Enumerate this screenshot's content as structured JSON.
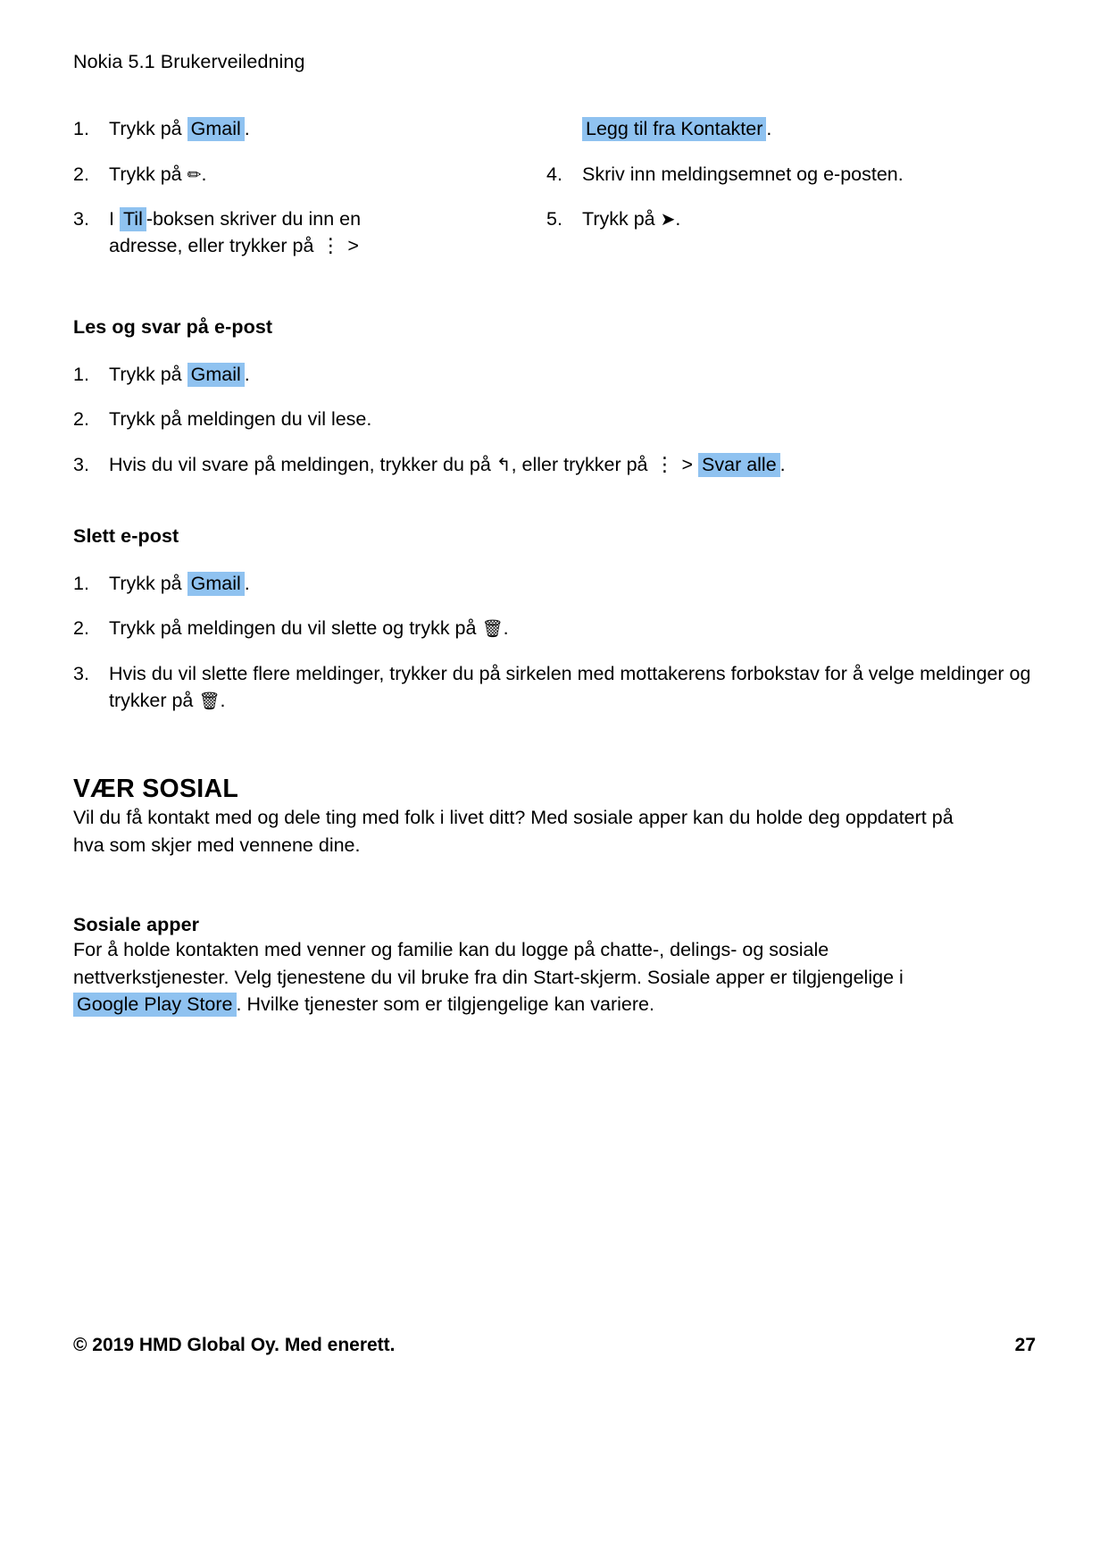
{
  "header": {
    "running_title": "Nokia 5.1 Brukerveiledning"
  },
  "compose_section": {
    "left_steps": [
      {
        "num": "1.",
        "pre": "Trykk på",
        "highlight": "Gmail",
        "post": "."
      },
      {
        "num": "2.",
        "pre": "Trykk på",
        "icon": "pencil-icon",
        "icon_glyph": "✏",
        "post": "."
      },
      {
        "num": "3.",
        "pre": "I",
        "highlight": "Til",
        "post": "-boksen skriver du inn en",
        "line2_pre": "adresse, eller trykker på",
        "line2_icon": "more-vertical-icon",
        "line2_icon_glyph": "⋮",
        "line2_post": ">"
      }
    ],
    "right_steps": [
      {
        "num": "",
        "highlight": "Legg til fra Kontakter",
        "post": "."
      },
      {
        "num": "4.",
        "text": "Skriv inn meldingsemnet og e-posten."
      },
      {
        "num": "5.",
        "pre": "Trykk på",
        "icon": "send-icon",
        "icon_glyph": "➤",
        "post": "."
      }
    ]
  },
  "read_section": {
    "heading": "Les og svar på e-post",
    "steps": [
      {
        "num": "1.",
        "pre": "Trykk på",
        "highlight": "Gmail",
        "post": "."
      },
      {
        "num": "2.",
        "text": "Trykk på meldingen du vil lese."
      },
      {
        "num": "3.",
        "pre": "Hvis du vil svare på meldingen, trykker du på",
        "icon_reply": "reply-icon",
        "icon_reply_glyph": "↰",
        "mid": ", eller trykker på",
        "icon_dots": "more-vertical-icon",
        "icon_dots_glyph": "⋮",
        "gt": ">",
        "highlight": "Svar alle",
        "post": "."
      }
    ]
  },
  "delete_section": {
    "heading": "Slett e-post",
    "steps": [
      {
        "num": "1.",
        "pre": "Trykk på",
        "highlight": "Gmail",
        "post": "."
      },
      {
        "num": "2.",
        "pre": "Trykk på meldingen du vil slette og trykk på",
        "icon": "trash-icon",
        "icon_glyph": "🗑",
        "post": "."
      },
      {
        "num": "3.",
        "pre": "Hvis du vil slette flere meldinger, trykker du på sirkelen med mottakerens forbokstav for å velge meldinger og trykker på",
        "icon": "trash-icon",
        "icon_glyph": "🗑",
        "post": "."
      }
    ]
  },
  "social_section": {
    "heading": "VÆR SOSIAL",
    "intro": "Vil du få kontakt med og dele ting med folk i livet ditt? Med sosiale apper kan du holde deg oppdatert på hva som skjer med vennene dine."
  },
  "apps_section": {
    "heading": "Sosiale apper",
    "body_pre": "For å holde kontakten med venner og familie kan du logge på chatte-, delings- og sosiale nettverkstjenester. Velg tjenestene du vil bruke fra din Start-skjerm. Sosiale apper er tilgjengelige i",
    "highlight": "Google Play Store",
    "body_post": ". Hvilke tjenester som er tilgjengelige kan variere."
  },
  "footer": {
    "copyright": "© 2019 HMD Global Oy. Med enerett.",
    "page_number": "27"
  },
  "colors": {
    "highlight": "#8fc2f0",
    "text": "#000000",
    "background": "#ffffff"
  }
}
